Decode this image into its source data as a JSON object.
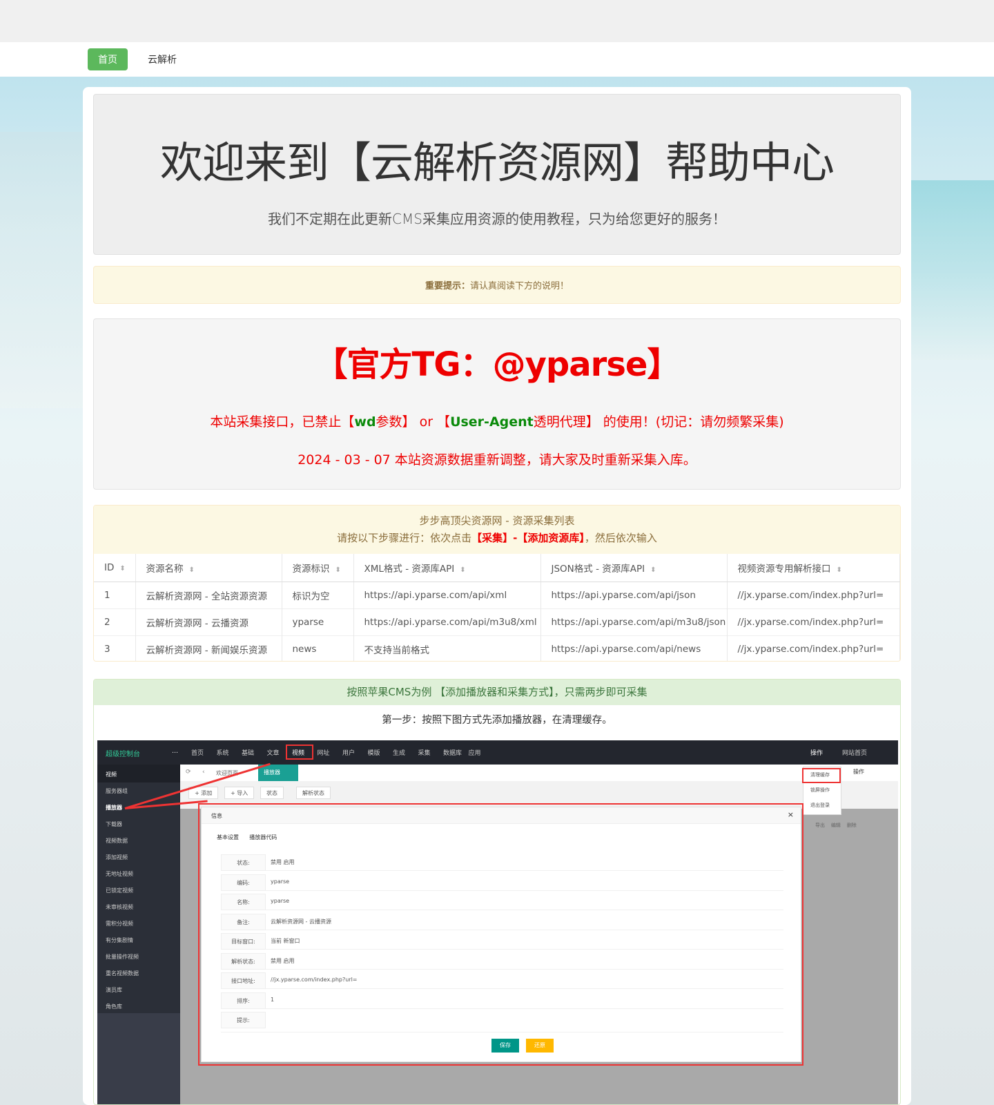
{
  "nav": {
    "home": "首页",
    "link": "云解析"
  },
  "jumbotron": {
    "title": "欢迎来到【云解析资源网】帮助中心",
    "subtitle": "我们不定期在此更新CMS采集应用资源的使用教程，只为给您更好的服务！"
  },
  "warning": {
    "label": "重要提示：",
    "text": "请认真阅读下方的说明！"
  },
  "notice": {
    "title": "【官方TG：@yparse】",
    "line1_a": "本站采集接口，已禁止【",
    "line1_wd": "wd",
    "line1_b": "参数】 or 【",
    "line1_ua": "User-Agent",
    "line1_c": "透明代理】 的使用！(切记：请勿频繁采集)",
    "line2": "2024 - 03 - 07 本站资源数据重新调整，请大家及时重新采集入库。"
  },
  "resources": {
    "title": "步步高顶尖资源网 - 资源采集列表",
    "instruction_a": "请按以下步骤进行：依次点击",
    "instruction_hl": "【采集】-【添加资源库】",
    "instruction_b": "，然后依次输入",
    "columns": [
      "ID",
      "资源名称",
      "资源标识",
      "XML格式 - 资源库API",
      "JSON格式 - 资源库API",
      "视频资源专用解析接口"
    ],
    "rows": [
      [
        "1",
        "云解析资源网 - 全站资源资源",
        "标识为空",
        "https://api.yparse.com/api/xml",
        "https://api.yparse.com/api/json",
        "//jx.yparse.com/index.php?url="
      ],
      [
        "2",
        "云解析资源网 - 云播资源",
        "yparse",
        "https://api.yparse.com/api/m3u8/xml",
        "https://api.yparse.com/api/m3u8/json",
        "//jx.yparse.com/index.php?url="
      ],
      [
        "3",
        "云解析资源网 - 新闻娱乐资源",
        "news",
        "不支持当前格式",
        "https://api.yparse.com/api/news",
        "//jx.yparse.com/index.php?url="
      ]
    ]
  },
  "guide": {
    "title": "按照苹果CMS为例 【添加播放器和采集方式】，只需两步即可采集",
    "step1": "第一步：按照下图方式先添加播放器，在清理缓存。"
  },
  "screenshot": {
    "logo": "超级控制台",
    "menu": [
      "首页",
      "系统",
      "基础",
      "文章",
      "视频",
      "网址",
      "用户",
      "模版",
      "生成",
      "采集",
      "数据库",
      "应用"
    ],
    "right_menu": [
      "操作",
      "网站首页"
    ],
    "side_head": "视频",
    "side_items": [
      "服务器组",
      "播放器",
      "下载器",
      "视频数据",
      "添加视频",
      "无地址视频",
      "已锁定视频",
      "未审核视频",
      "需积分视频",
      "有分集剧情",
      "批量操作视频",
      "重名视频数据",
      "演员库",
      "角色库"
    ],
    "tabs": [
      "欢迎页面",
      "播放器"
    ],
    "tool_buttons": [
      "+ 添加",
      "+ 导入",
      "状态",
      "解析状态"
    ],
    "dropdown": [
      "清理缓存",
      "锁屏操作",
      "退出登录"
    ],
    "ops_label": "操作",
    "row_ops": [
      "导出",
      "编辑",
      "删除"
    ],
    "modal": {
      "title": "信息",
      "tabs": [
        "基本设置",
        "播放器代码"
      ],
      "fields": [
        {
          "label": "状态:",
          "value": "禁用   启用"
        },
        {
          "label": "编码:",
          "value": "yparse"
        },
        {
          "label": "名称:",
          "value": "yparse"
        },
        {
          "label": "备注:",
          "value": "云解析资源网 - 云播资源"
        },
        {
          "label": "目标窗口:",
          "value": "当前   新窗口"
        },
        {
          "label": "解析状态:",
          "value": "禁用   启用"
        },
        {
          "label": "接口地址:",
          "value": "//jx.yparse.com/index.php?url="
        },
        {
          "label": "排序:",
          "value": "1"
        },
        {
          "label": "提示:",
          "value": ""
        }
      ],
      "save": "保存",
      "reset": "还原"
    }
  }
}
